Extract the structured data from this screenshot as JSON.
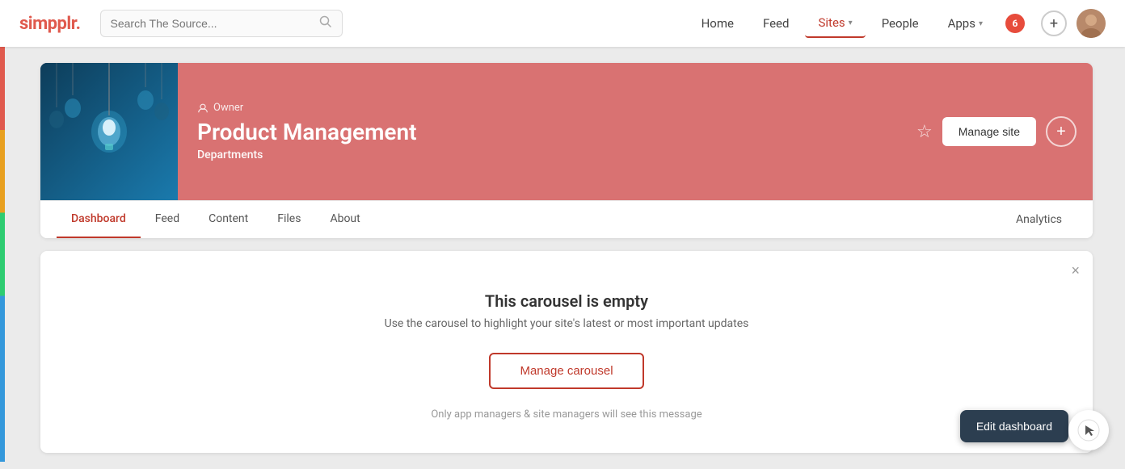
{
  "brand": {
    "logo": "simpplr.",
    "logo_color": "#e05a4e"
  },
  "search": {
    "placeholder": "Search The Source..."
  },
  "nav": {
    "links": [
      {
        "id": "home",
        "label": "Home",
        "active": false,
        "has_chevron": false
      },
      {
        "id": "feed",
        "label": "Feed",
        "active": false,
        "has_chevron": false
      },
      {
        "id": "sites",
        "label": "Sites",
        "active": true,
        "has_chevron": true
      },
      {
        "id": "people",
        "label": "People",
        "active": false,
        "has_chevron": false
      },
      {
        "id": "apps",
        "label": "Apps",
        "active": false,
        "has_chevron": true
      }
    ],
    "notification_count": "6",
    "plus_icon": "+"
  },
  "site": {
    "owner_label": "Owner",
    "title": "Product Management",
    "department": "Departments",
    "manage_site_label": "Manage site",
    "plus_icon": "+",
    "tabs": [
      {
        "id": "dashboard",
        "label": "Dashboard",
        "active": true
      },
      {
        "id": "feed",
        "label": "Feed",
        "active": false
      },
      {
        "id": "content",
        "label": "Content",
        "active": false
      },
      {
        "id": "files",
        "label": "Files",
        "active": false
      },
      {
        "id": "about",
        "label": "About",
        "active": false
      }
    ],
    "analytics_tab": "Analytics"
  },
  "carousel": {
    "title": "This carousel is empty",
    "description": "Use the carousel to highlight your site's latest or most important updates",
    "manage_label": "Manage carousel",
    "note": "Only app managers & site managers will see this message",
    "close_icon": "×"
  },
  "edit_dashboard": {
    "label": "Edit dashboard"
  }
}
